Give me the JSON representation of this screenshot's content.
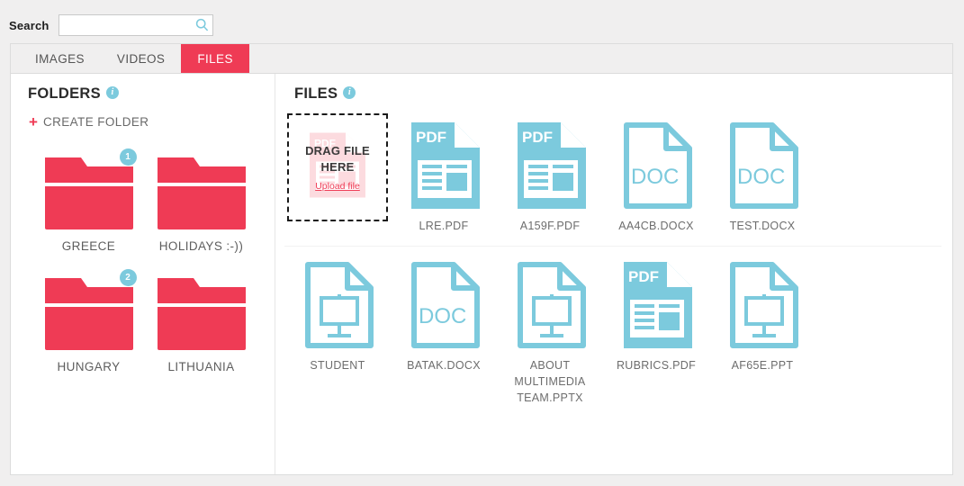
{
  "search": {
    "label": "Search",
    "value": "",
    "placeholder": "",
    "icon": "search-icon"
  },
  "tabs": [
    {
      "label": "IMAGES",
      "active": false
    },
    {
      "label": "VIDEOS",
      "active": false
    },
    {
      "label": "FILES",
      "active": true
    }
  ],
  "folders_panel": {
    "title": "FOLDERS",
    "info_icon": "info-icon",
    "info_char": "i",
    "create_folder": {
      "plus": "+",
      "label": "CREATE FOLDER"
    },
    "items": [
      {
        "name": "GREECE",
        "badge": "1"
      },
      {
        "name": "HOLIDAYS :-))",
        "badge": ""
      },
      {
        "name": "HUNGARY",
        "badge": "2"
      },
      {
        "name": "LITHUANIA",
        "badge": ""
      }
    ]
  },
  "files_panel": {
    "title": "FILES",
    "info_icon": "info-icon",
    "info_char": "i",
    "drop_zone": {
      "line1": "DRAG FILE",
      "line2": "HERE",
      "link": "Upload file",
      "watermark_icon": "pdf-file-icon"
    },
    "rows": [
      [
        {
          "name": "LRE.PDF",
          "type": "pdf",
          "badge_text": "PDF"
        },
        {
          "name": "A159F.PDF",
          "type": "pdf",
          "badge_text": "PDF"
        },
        {
          "name": "AA4CB.DOCX",
          "type": "doc",
          "badge_text": "DOC"
        },
        {
          "name": "TEST.DOCX",
          "type": "doc",
          "badge_text": "DOC"
        }
      ],
      [
        {
          "name": "STUDENT",
          "type": "ppt",
          "badge_text": ""
        },
        {
          "name": "BATAK.DOCX",
          "type": "doc",
          "badge_text": "DOC"
        },
        {
          "name": "ABOUT MULTIMEDIA TEAM.PPTX",
          "type": "ppt",
          "badge_text": ""
        },
        {
          "name": "RUBRICS.PDF",
          "type": "pdf",
          "badge_text": "PDF"
        },
        {
          "name": "AF65E.PPT",
          "type": "ppt",
          "badge_text": ""
        }
      ]
    ]
  },
  "colors": {
    "accent_red": "#ef3b55",
    "accent_teal": "#7ccadd",
    "page_background": "#f0efef",
    "panel_background": "#ffffff",
    "text_gray": "#6d6d6d"
  }
}
